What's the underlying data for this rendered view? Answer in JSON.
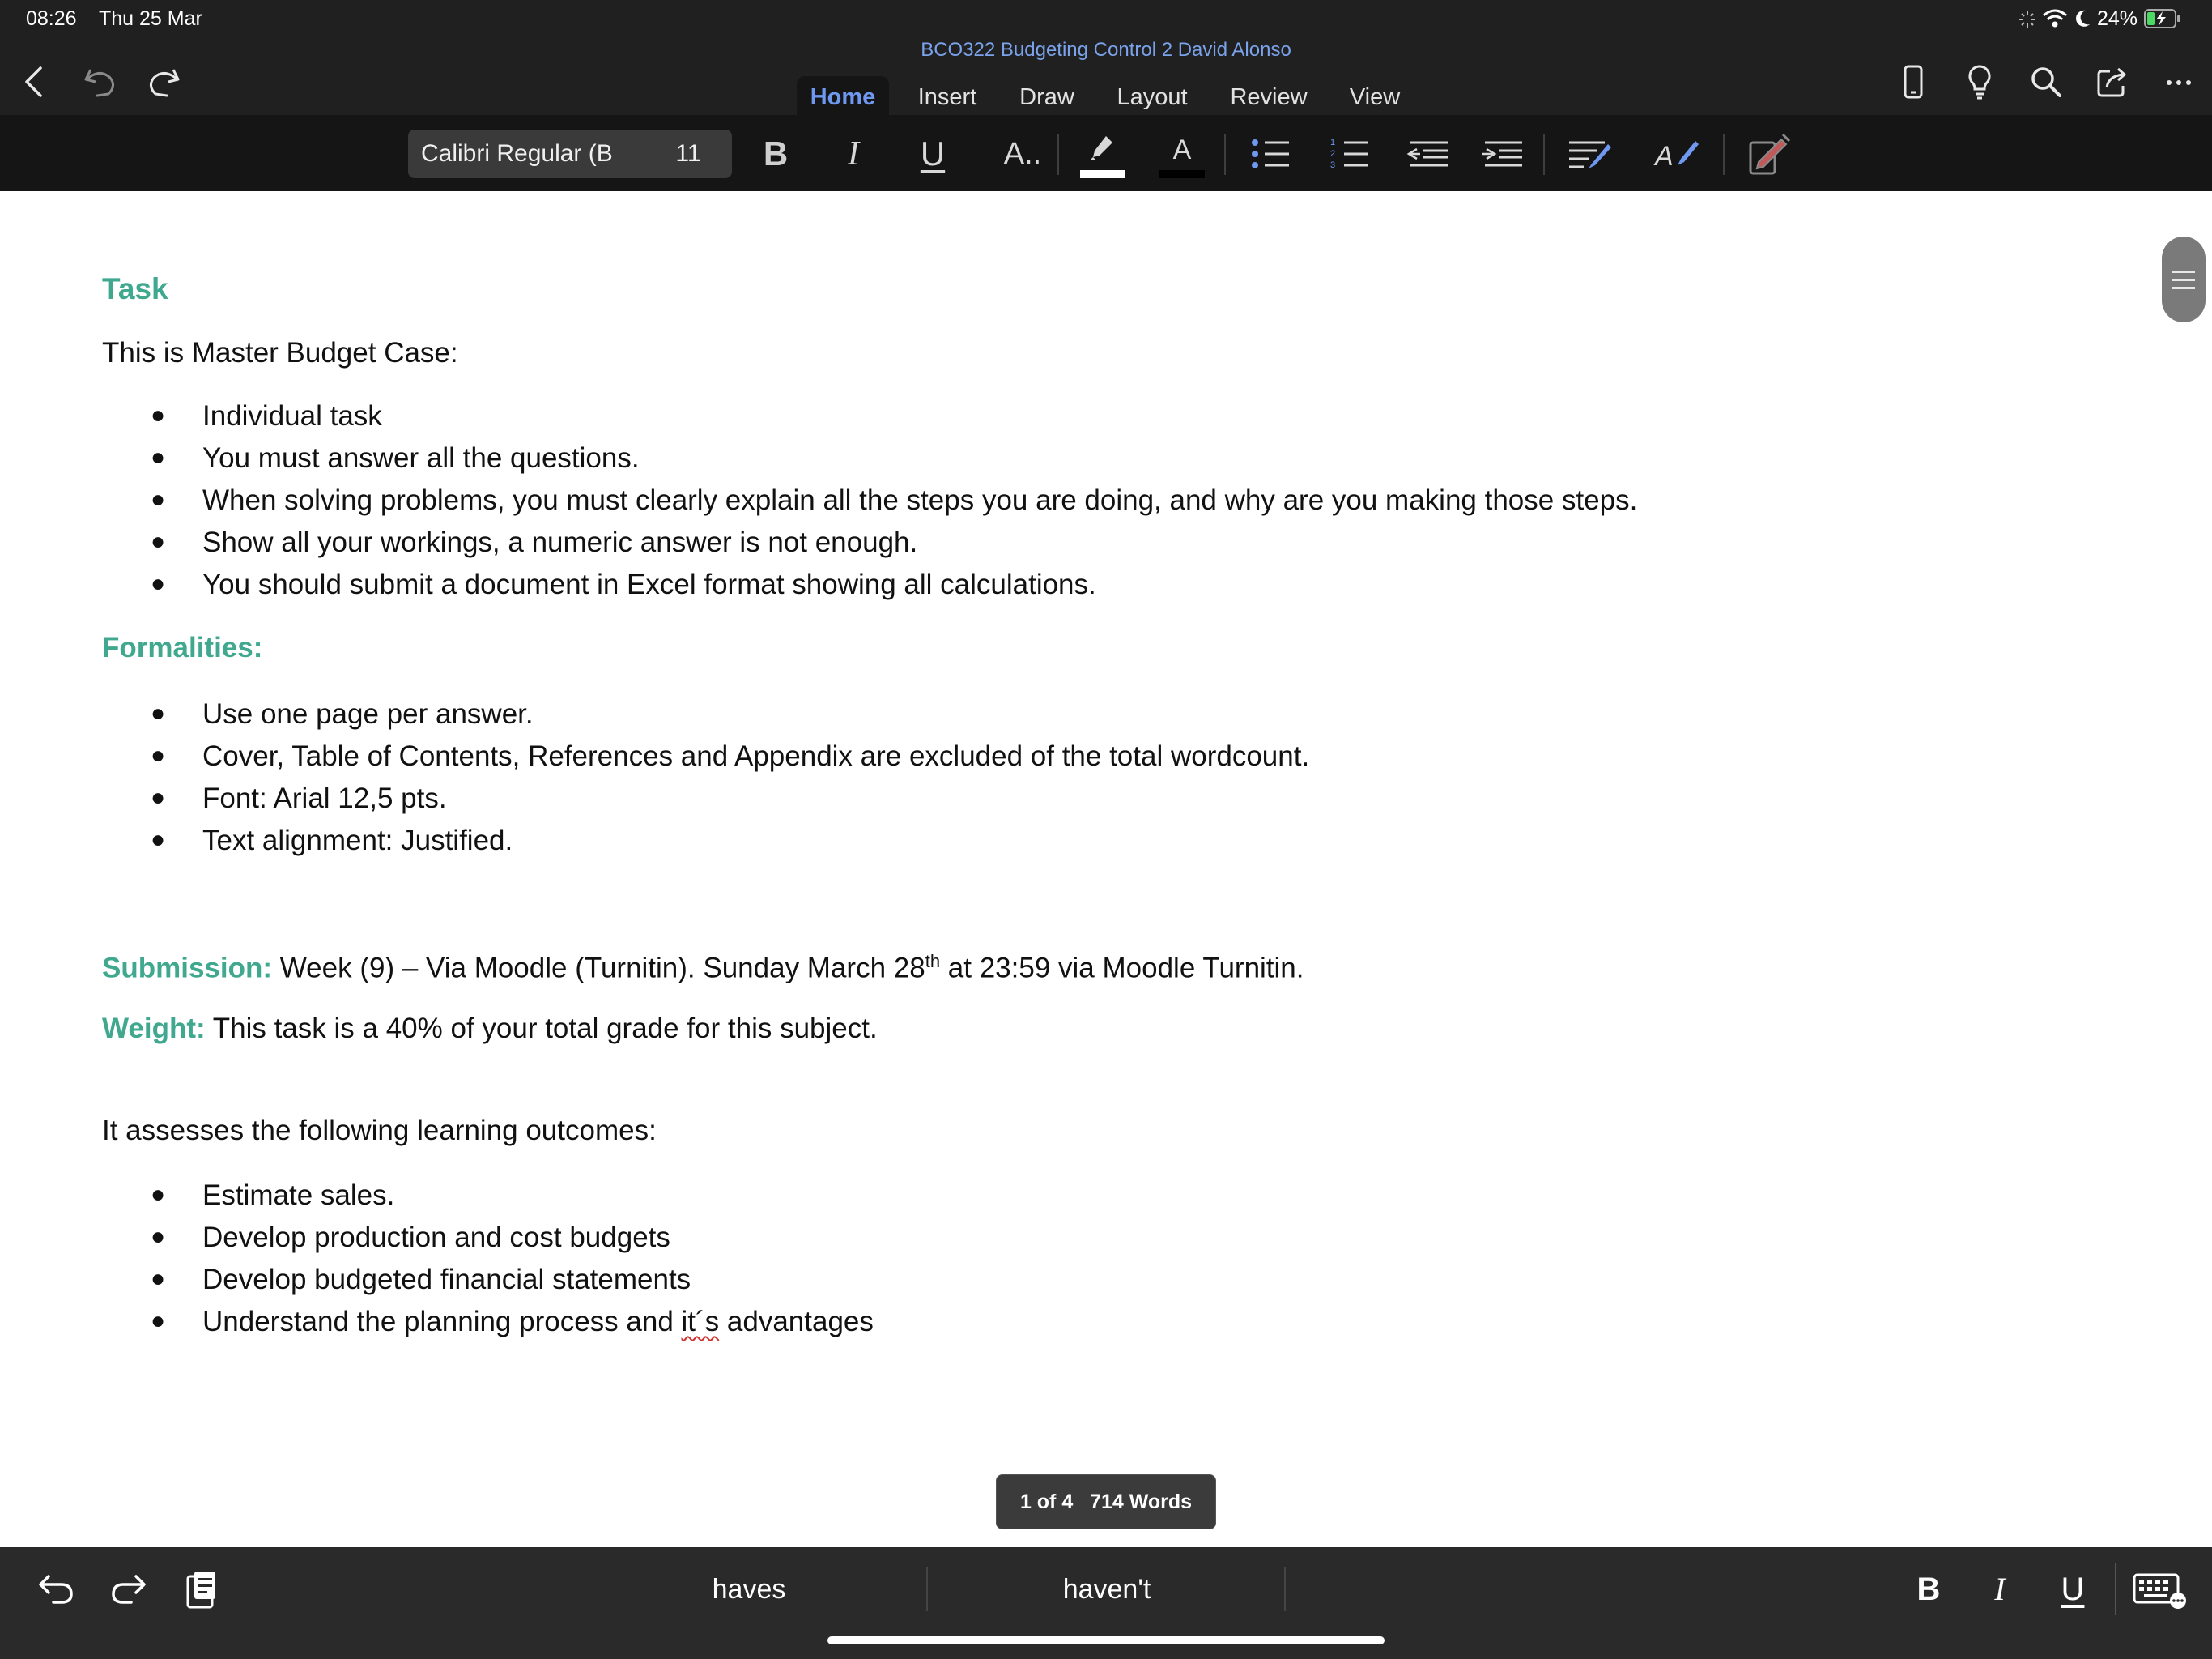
{
  "status_bar": {
    "time": "08:26",
    "date": "Thu 25 Mar",
    "battery": "24%"
  },
  "app": {
    "document_title": "BCO322 Budgeting  Control 2 David Alonso",
    "tabs": [
      "Home",
      "Insert",
      "Draw",
      "Layout",
      "Review",
      "View"
    ],
    "active_tab": "Home"
  },
  "ribbon": {
    "font_name": "Calibri Regular (B",
    "font_size": "11",
    "bold": "B",
    "italic": "I",
    "underline": "U",
    "text_effects": "A..",
    "font_color_letter": "A",
    "highlight_color": "#ffffff",
    "font_color": "#000000"
  },
  "document": {
    "task_heading": "Task",
    "intro": "This is Master Budget Case:",
    "task_items": [
      "Individual task",
      "You must answer all the questions.",
      "When solving problems, you must clearly explain all the steps you are doing, and why are you making those steps.",
      "Show all your workings, a numeric answer is not enough.",
      "You should submit a document in Excel format showing all calculations."
    ],
    "formalities_heading": "Formalities:",
    "formalities_items": [
      "Use one page per answer.",
      "Cover, Table of Contents, References and Appendix are excluded of the total wordcount.",
      "Font: Arial 12,5 pts.",
      "Text alignment: Justified."
    ],
    "submission_label": "Submission:",
    "submission_text": "Week (9) – Via Moodle (Turnitin). Sunday March 28",
    "submission_sup": "th",
    "submission_text_end": "at 23:59 via Moodle Turnitin.",
    "weight_label": "Weight:",
    "weight_text": "This task is a 40% of your total grade for this subject.",
    "outcomes_intro": "It assesses the following learning outcomes:",
    "outcomes_items": [
      "Estimate sales.",
      "Develop production and cost budgets",
      "Develop budgeted financial statements"
    ],
    "outcome_last_before": "Understand the planning process and ",
    "outcome_last_misspelled": "it´s",
    "outcome_last_after": " advantages"
  },
  "page_counter": {
    "page": "1 of 4",
    "words": "714 Words"
  },
  "keyboard_bar": {
    "suggestions": [
      "haves",
      "haven't"
    ],
    "bold": "B",
    "italic": "I",
    "underline": "U"
  },
  "colors": {
    "heading": "#3fa88f",
    "accent": "#6f98f0",
    "toolbar": "#202020"
  }
}
